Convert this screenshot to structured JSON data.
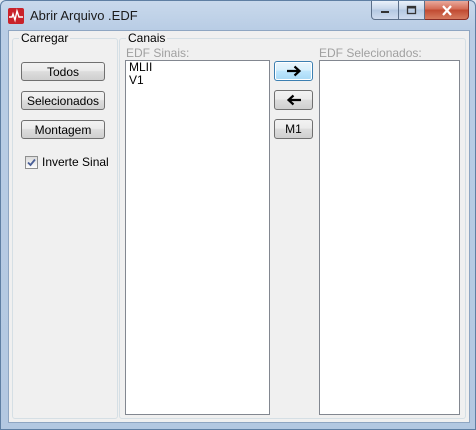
{
  "window": {
    "title": "Abrir Arquivo .EDF"
  },
  "carregar": {
    "label": "Carregar",
    "buttons": {
      "todos": "Todos",
      "selecionados": "Selecionados",
      "montagem": "Montagem"
    },
    "checkbox": {
      "label": "Inverte Sinal",
      "checked": true
    }
  },
  "canais": {
    "label": "Canais",
    "edf_sinais_label": "EDF Sinais:",
    "edf_sinais_items": [
      "MLII",
      "V1"
    ],
    "edf_selecionados_label": "EDF Selecionados:",
    "edf_selecionados_items": [],
    "buttons": {
      "add": "➔",
      "remove": "🡐",
      "m1": "M1"
    }
  }
}
